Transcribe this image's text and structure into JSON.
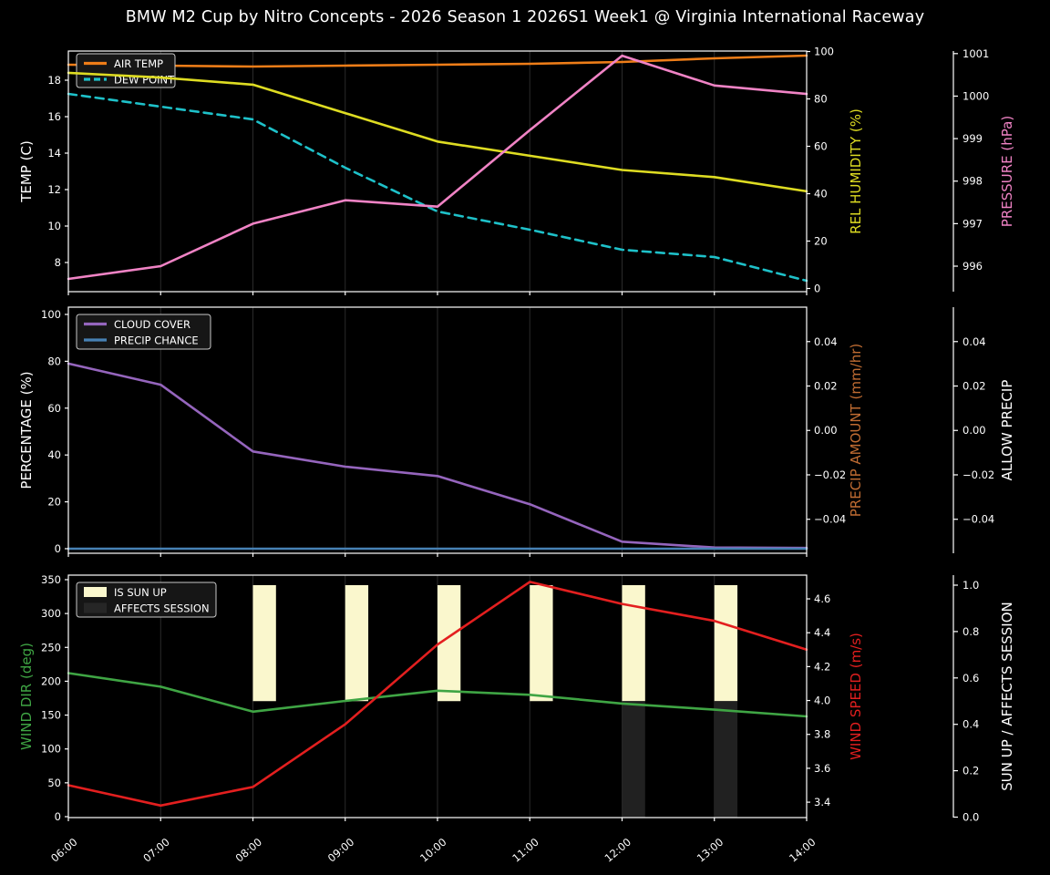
{
  "title": "BMW M2 Cup by Nitro Concepts - 2026 Season 1 2026S1 Week1 @ Virginia International Raceway",
  "x_axis": {
    "hours": [
      6,
      7,
      8,
      9,
      10,
      11,
      12,
      13,
      14
    ],
    "tick_labels": [
      "06:00",
      "07:00",
      "08:00",
      "09:00",
      "10:00",
      "11:00",
      "12:00",
      "13:00",
      "14:00"
    ]
  },
  "colors": {
    "background": "#000000",
    "text": "#ffffff",
    "grid": "#2b2b2b",
    "spine": "#ffffff",
    "legend_bg": "#161616",
    "legend_border": "#c8c8c8",
    "air_temp": "#ee7d18",
    "dew_point": "#1ec1c9",
    "rel_humidity": "#dedc22",
    "pressure": "#f083c5",
    "cloud_cover": "#9565bd",
    "precip_chance": "#4781b4",
    "precip_amount": "#c06c32",
    "allow_precip": "#ffffff",
    "wind_dir": "#3fa544",
    "wind_speed": "#e31f1f",
    "sun_up": "#faf7cd",
    "affects_session": "#212121"
  },
  "chart_data": [
    {
      "type": "line",
      "panel": "temperature",
      "x": [
        6,
        7,
        8,
        9,
        10,
        11,
        12,
        13,
        14
      ],
      "legend_position": "upper left",
      "grid": "vertical-only",
      "axes": {
        "temp": {
          "side": "left",
          "label": "TEMP (C)",
          "label_color": "#ffffff",
          "ticks": [
            8,
            10,
            12,
            14,
            16,
            18
          ],
          "tick_labels": [
            "8",
            "10",
            "12",
            "14",
            "16",
            "18"
          ],
          "ylim": [
            6.4,
            19.6
          ]
        },
        "humidity": {
          "side": "right_inner",
          "label": "REL HUMIDITY (%)",
          "label_color": "#dedc22",
          "ticks": [
            0,
            20,
            40,
            60,
            80,
            100
          ],
          "tick_labels": [
            "0",
            "20",
            "40",
            "60",
            "80",
            "100"
          ],
          "ylim": [
            -1.35,
            100.2
          ]
        },
        "pressure": {
          "side": "right_outer",
          "label": "PRESSURE (hPa)",
          "label_color": "#f083c5",
          "ticks": [
            996,
            997,
            998,
            999,
            1000,
            1001
          ],
          "tick_labels": [
            "996",
            "997",
            "998",
            "999",
            "1000",
            "1001"
          ],
          "ylim": [
            995.4,
            1001.06
          ]
        }
      },
      "series": [
        {
          "name": "AIR TEMP",
          "axis": "temp",
          "color": "#ee7d18",
          "dash": false,
          "values": [
            18.85,
            18.8,
            18.75,
            18.8,
            18.85,
            18.9,
            19.0,
            19.2,
            19.35
          ]
        },
        {
          "name": "DEW POINT",
          "axis": "temp",
          "color": "#1ec1c9",
          "dash": true,
          "values": [
            17.25,
            16.55,
            15.85,
            13.2,
            10.8,
            9.8,
            8.7,
            8.3,
            7.0
          ]
        },
        {
          "name": "REL HUMIDITY",
          "axis": "humidity",
          "color": "#dedc22",
          "dash": false,
          "values": [
            91,
            89,
            86,
            74,
            62,
            56,
            50,
            47,
            41
          ]
        },
        {
          "name": "PRESSURE",
          "axis": "pressure",
          "color": "#f083c5",
          "dash": false,
          "values": [
            995.7,
            996.0,
            997.0,
            997.55,
            997.4,
            999.2,
            1000.95,
            1000.25,
            1000.05
          ]
        }
      ],
      "legend": [
        {
          "label": "AIR TEMP",
          "swatch": "line",
          "color": "#ee7d18",
          "dash": false
        },
        {
          "label": "DEW POINT",
          "swatch": "line",
          "color": "#1ec1c9",
          "dash": true
        }
      ]
    },
    {
      "type": "line",
      "panel": "percentage",
      "x": [
        6,
        7,
        8,
        9,
        10,
        11,
        12,
        13,
        14
      ],
      "legend_position": "upper left",
      "grid": "vertical-only",
      "axes": {
        "pct": {
          "side": "left",
          "label": "PERCENTAGE (%)",
          "label_color": "#ffffff",
          "ticks": [
            0,
            20,
            40,
            60,
            80,
            100
          ],
          "tick_labels": [
            "0",
            "20",
            "40",
            "60",
            "80",
            "100"
          ],
          "ylim": [
            -1.95,
            103.1
          ]
        },
        "precip": {
          "side": "right_inner",
          "label": "PRECIP AMOUNT  (mm/hr)",
          "label_color": "#c06c32",
          "ticks": [
            0.04,
            0.02,
            0,
            -0.02,
            -0.04
          ],
          "tick_labels": [
            "0.04",
            "0.02",
            "0.00",
            "−0.02",
            "−0.04"
          ],
          "ylim": [
            -0.0553,
            0.0555
          ]
        },
        "allow": {
          "side": "right_outer",
          "label": "ALLOW PRECIP",
          "label_color": "#ffffff",
          "ticks": [
            0.04,
            0.02,
            0,
            -0.02,
            -0.04
          ],
          "tick_labels": [
            "0.04",
            "0.02",
            "0.00",
            "−0.02",
            "−0.04"
          ],
          "ylim": [
            -0.0553,
            0.0555
          ]
        }
      },
      "series": [
        {
          "name": "CLOUD COVER",
          "axis": "pct",
          "color": "#9565bd",
          "dash": false,
          "values": [
            79,
            70,
            41.5,
            35,
            31,
            19,
            3,
            0.5,
            0.3
          ]
        },
        {
          "name": "PRECIP CHANCE",
          "axis": "pct",
          "color": "#4781b4",
          "dash": false,
          "values": [
            0,
            0,
            0,
            0,
            0,
            0,
            0,
            0,
            0
          ]
        }
      ],
      "legend": [
        {
          "label": "CLOUD COVER",
          "swatch": "line",
          "color": "#9565bd",
          "dash": false
        },
        {
          "label": "PRECIP CHANCE",
          "swatch": "line",
          "color": "#4781b4",
          "dash": false
        }
      ]
    },
    {
      "type": "line",
      "panel": "wind",
      "x": [
        6,
        7,
        8,
        9,
        10,
        11,
        12,
        13,
        14
      ],
      "legend_position": "upper left",
      "grid": "vertical-only",
      "axes": {
        "winddir": {
          "side": "left",
          "label": "WIND DIR (deg)",
          "label_color": "#3fa544",
          "ticks": [
            0,
            50,
            100,
            150,
            200,
            250,
            300,
            350
          ],
          "tick_labels": [
            "0",
            "50",
            "100",
            "150",
            "200",
            "250",
            "300",
            "350"
          ],
          "ylim": [
            -1.35,
            356.7
          ]
        },
        "windspeed": {
          "side": "right_inner",
          "label": "WIND SPEED (m/s)",
          "label_color": "#e31f1f",
          "ticks": [
            3.4,
            3.6,
            3.8,
            4.0,
            4.2,
            4.4,
            4.6
          ],
          "tick_labels": [
            "3.4",
            "3.6",
            "3.8",
            "4.0",
            "4.2",
            "4.4",
            "4.6"
          ],
          "ylim": [
            3.309,
            4.74
          ]
        },
        "sun": {
          "side": "right_outer",
          "label": "SUN UP / AFFECTS SESSION",
          "label_color": "#ffffff",
          "ticks": [
            0.0,
            0.2,
            0.4,
            0.6,
            0.8,
            1.0
          ],
          "tick_labels": [
            "0.0",
            "0.2",
            "0.4",
            "0.6",
            "0.8",
            "1.0"
          ],
          "ylim": [
            -0.002,
            1.0432
          ]
        }
      },
      "bars": [
        {
          "name": "IS SUN UP",
          "axis": "sun",
          "color": "#faf7cd",
          "hours": [
            8,
            9,
            10,
            11,
            12,
            13
          ],
          "width_hours": 0.25,
          "span": [
            0.5,
            1.0
          ]
        },
        {
          "name": "AFFECTS SESSION",
          "axis": "sun",
          "color": "#212121",
          "hours": [
            12,
            13
          ],
          "width_hours": 0.25,
          "span": [
            0.0,
            0.5
          ]
        }
      ],
      "series": [
        {
          "name": "WIND DIR",
          "axis": "winddir",
          "color": "#3fa544",
          "dash": false,
          "values": [
            212,
            192,
            155,
            171,
            186,
            180,
            167,
            158,
            148
          ]
        },
        {
          "name": "WIND SPEED",
          "axis": "windspeed",
          "color": "#e31f1f",
          "dash": false,
          "values": [
            3.5,
            3.38,
            3.49,
            3.86,
            4.33,
            4.7,
            4.57,
            4.47,
            4.3
          ]
        }
      ],
      "legend": [
        {
          "label": "IS SUN UP",
          "swatch": "rect",
          "color": "#faf7cd"
        },
        {
          "label": "AFFECTS SESSION",
          "swatch": "rect",
          "color": "#262626"
        }
      ]
    }
  ]
}
